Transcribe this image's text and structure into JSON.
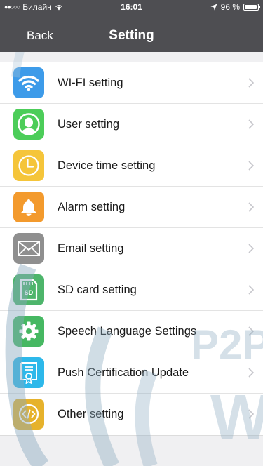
{
  "status_bar": {
    "carrier": "Билайн",
    "time": "16:01",
    "battery": "96 %",
    "battery_level": 0.96
  },
  "nav": {
    "back_label": "Back",
    "title": "Setting"
  },
  "settings": [
    {
      "label": "WI-FI setting",
      "icon": "wifi-icon",
      "color": "#3d9be9"
    },
    {
      "label": "User setting",
      "icon": "user-icon",
      "color": "#4ccd59"
    },
    {
      "label": "Device time setting",
      "icon": "clock-icon",
      "color": "#f5c53a"
    },
    {
      "label": "Alarm setting",
      "icon": "bell-icon",
      "color": "#f39a2d"
    },
    {
      "label": "Email setting",
      "icon": "envelope-icon",
      "color": "#8f8f8f"
    },
    {
      "label": "SD card setting",
      "icon": "sd-card-icon",
      "color": "#4db56b"
    },
    {
      "label": "Speech Language Settings",
      "icon": "gear-icon",
      "color": "#46b862"
    },
    {
      "label": "Push Certification Update",
      "icon": "certificate-icon",
      "color": "#2db8ea"
    },
    {
      "label": "Other setting",
      "icon": "code-icon",
      "color": "#e6b22c"
    }
  ],
  "colors": {
    "header": "#4e4e52",
    "background": "#f0f0f2",
    "chevron": "#c7c7cc"
  },
  "watermark": {
    "text": "P2P",
    "w_text": "W"
  }
}
